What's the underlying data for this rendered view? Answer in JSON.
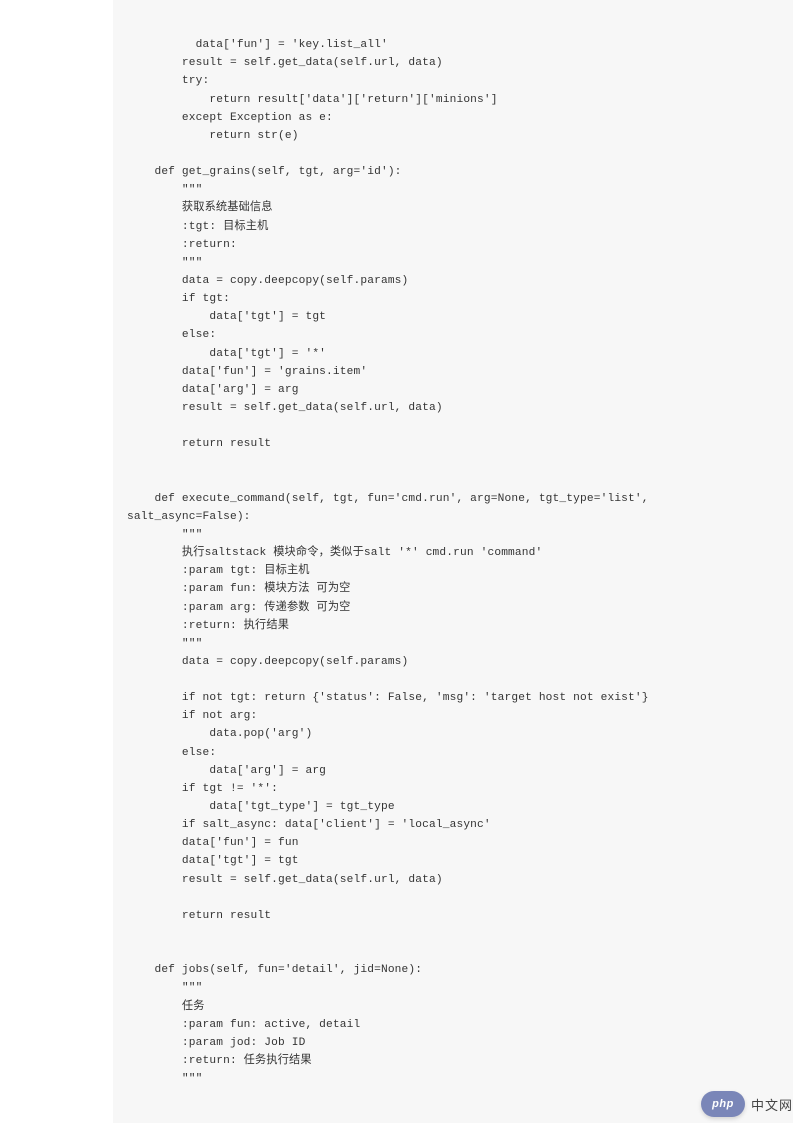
{
  "code": {
    "content": "        data['fun'] = 'key.list_all'\n        result = self.get_data(self.url, data)\n        try:\n            return result['data']['return']['minions']\n        except Exception as e:\n            return str(e)\n\n    def get_grains(self, tgt, arg='id'):\n        \"\"\"\n        获取系统基础信息\n        :tgt: 目标主机\n        :return:\n        \"\"\"\n        data = copy.deepcopy(self.params)\n        if tgt:\n            data['tgt'] = tgt\n        else:\n            data['tgt'] = '*'\n        data['fun'] = 'grains.item'\n        data['arg'] = arg\n        result = self.get_data(self.url, data)\n\n        return result\n\n\n    def execute_command(self, tgt, fun='cmd.run', arg=None, tgt_type='list', \nsalt_async=False):\n        \"\"\"\n        执行saltstack 模块命令，类似于salt '*' cmd.run 'command'\n        :param tgt: 目标主机\n        :param fun: 模块方法 可为空\n        :param arg: 传递参数 可为空\n        :return: 执行结果\n        \"\"\"\n        data = copy.deepcopy(self.params)\n\n        if not tgt: return {'status': False, 'msg': 'target host not exist'}\n        if not arg:\n            data.pop('arg')\n        else:\n            data['arg'] = arg\n        if tgt != '*':\n            data['tgt_type'] = tgt_type\n        if salt_async: data['client'] = 'local_async'\n        data['fun'] = fun\n        data['tgt'] = tgt\n        result = self.get_data(self.url, data)\n\n        return result\n\n\n    def jobs(self, fun='detail', jid=None):\n        \"\"\"\n        任务\n        :param fun: active, detail\n        :param jod: Job ID\n        :return: 任务执行结果\n        \"\"\""
  },
  "watermark": {
    "badge": "php",
    "text": "中文网"
  }
}
